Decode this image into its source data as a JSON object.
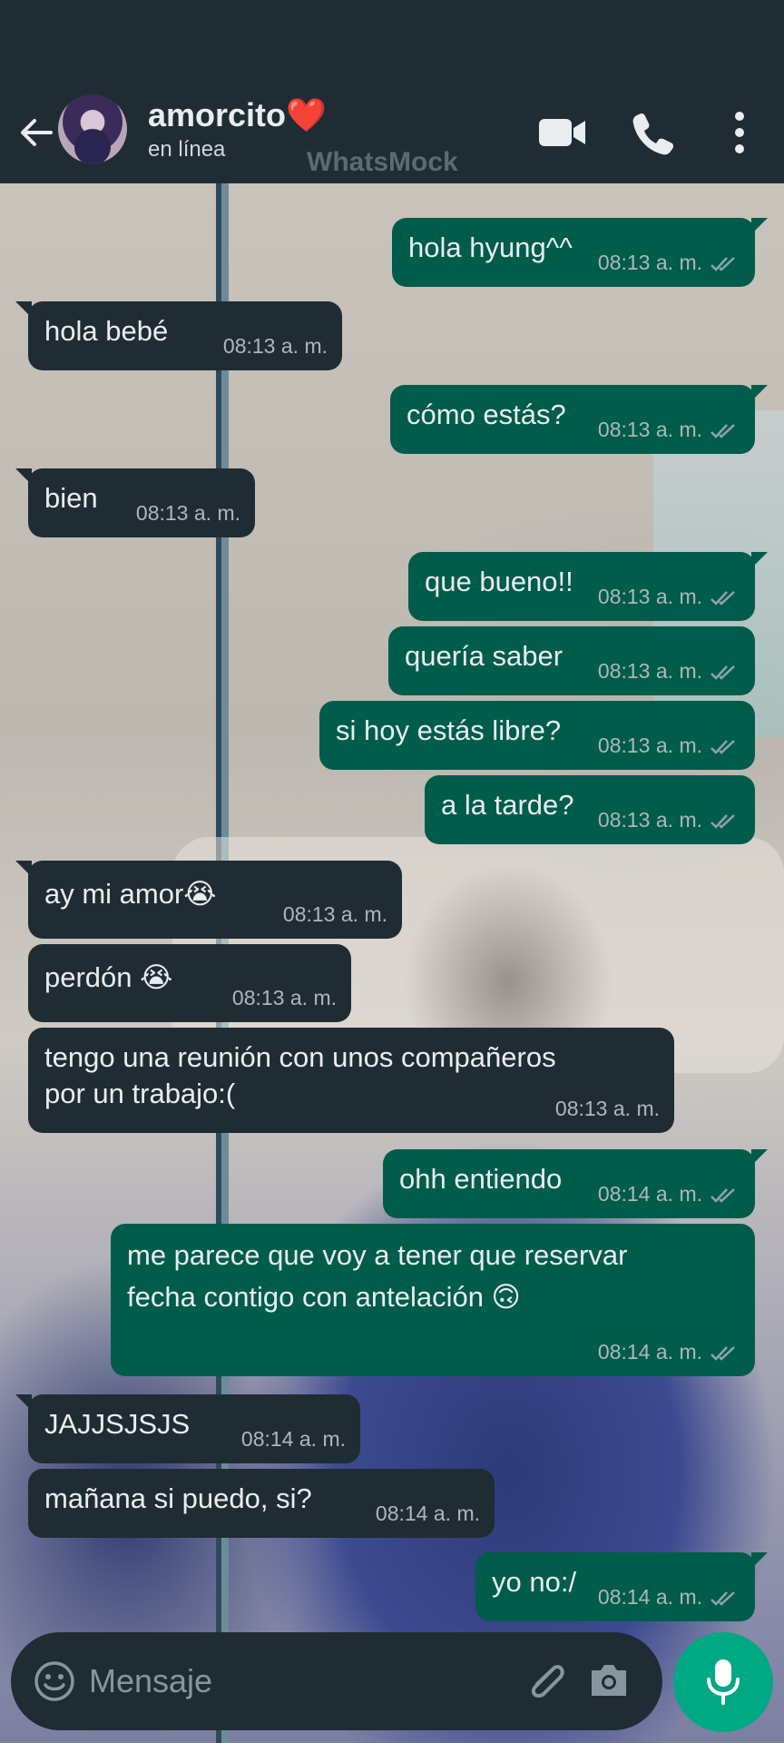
{
  "header": {
    "contact_name": "amorcito❤️",
    "contact_status": "en línea",
    "watermark": "WhatsMock"
  },
  "messages": [
    {
      "dir": "out",
      "text": "hola hyung^^",
      "time": "08:13 a. m."
    },
    {
      "dir": "in",
      "text": "hola bebé",
      "time": "08:13 a. m."
    },
    {
      "dir": "out",
      "text": "cómo estás?",
      "time": "08:13 a. m."
    },
    {
      "dir": "in",
      "text": "bien",
      "time": "08:13 a. m."
    },
    {
      "dir": "out",
      "text": "que bueno!!",
      "time": "08:13 a. m."
    },
    {
      "dir": "out",
      "text": "quería saber",
      "time": "08:13 a. m."
    },
    {
      "dir": "out",
      "text": "si hoy estás libre?",
      "time": "08:13 a. m."
    },
    {
      "dir": "out",
      "text": "a la tarde?",
      "time": "08:13 a. m."
    },
    {
      "dir": "in",
      "text": "ay mi amor😭",
      "time": "08:13 a. m."
    },
    {
      "dir": "in",
      "text": "perdón 😭",
      "time": "08:13 a. m."
    },
    {
      "dir": "in",
      "text_lines": [
        "tengo una reunión con unos compañeros",
        "por un trabajo:("
      ],
      "time": "08:13 a. m."
    },
    {
      "dir": "out",
      "text": "ohh entiendo",
      "time": "08:14 a. m."
    },
    {
      "dir": "out",
      "text_lines": [
        "me parece que voy a tener que reservar",
        "fecha contigo con antelación 🙃"
      ],
      "time": "08:14 a. m."
    },
    {
      "dir": "in",
      "text": "JAJJSJSJS",
      "time": "08:14 a. m."
    },
    {
      "dir": "in",
      "text": "mañana si puedo, si?",
      "time": "08:14 a. m."
    },
    {
      "dir": "out",
      "text": "yo no:/",
      "time": "08:14 a. m."
    }
  ],
  "input": {
    "placeholder": "Mensaje"
  },
  "colors": {
    "header_bg": "#1f2c34",
    "outgoing_bubble": "#005c4b",
    "incoming_bubble": "#202c33",
    "mic_button": "#00a884"
  },
  "icons": [
    "back-arrow-icon",
    "video-call-icon",
    "phone-icon",
    "more-options-icon",
    "emoji-icon",
    "attach-icon",
    "camera-icon",
    "mic-icon",
    "double-check-icon"
  ]
}
